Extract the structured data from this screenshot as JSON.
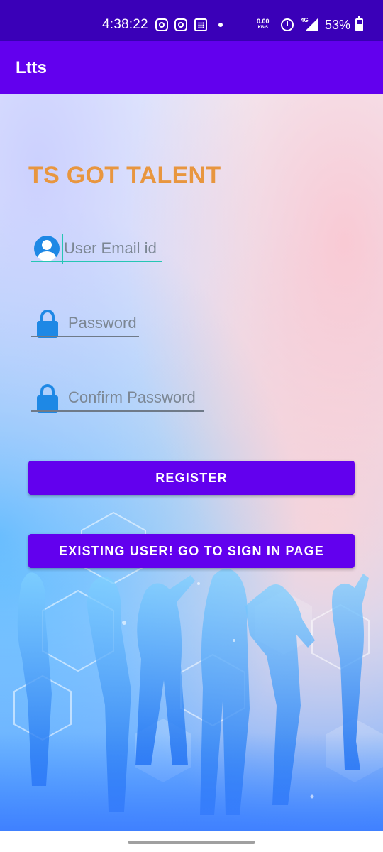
{
  "status_bar": {
    "time": "4:38:22",
    "net_speed_value": "0.00",
    "net_speed_unit": "KB/S",
    "network_type": "4G",
    "battery_percent": "53%",
    "icons": [
      "instagram-icon",
      "instagram-icon",
      "calculator-icon",
      "notification-dot",
      "alarm-icon",
      "signal-icon",
      "battery-icon"
    ]
  },
  "app_bar": {
    "title": "Ltts",
    "color": "#6200ee"
  },
  "page": {
    "heading": "TS GOT TALENT",
    "heading_color": "#e8963f"
  },
  "form": {
    "email": {
      "placeholder": "User Email id",
      "value": "",
      "icon": "user-avatar-icon",
      "focused": true
    },
    "password": {
      "placeholder": "Password",
      "value": "",
      "icon": "lock-icon"
    },
    "confirm_password": {
      "placeholder": "Confirm Password",
      "value": "",
      "icon": "lock-icon"
    }
  },
  "buttons": {
    "register": "REGISTER",
    "sign_in": "EXISTING USER! GO TO SIGN IN PAGE",
    "color": "#6200ee"
  },
  "colors": {
    "status_bar": "#3a00b8",
    "accent_focus": "#26c6b4",
    "icon_blue": "#1e88e5"
  }
}
